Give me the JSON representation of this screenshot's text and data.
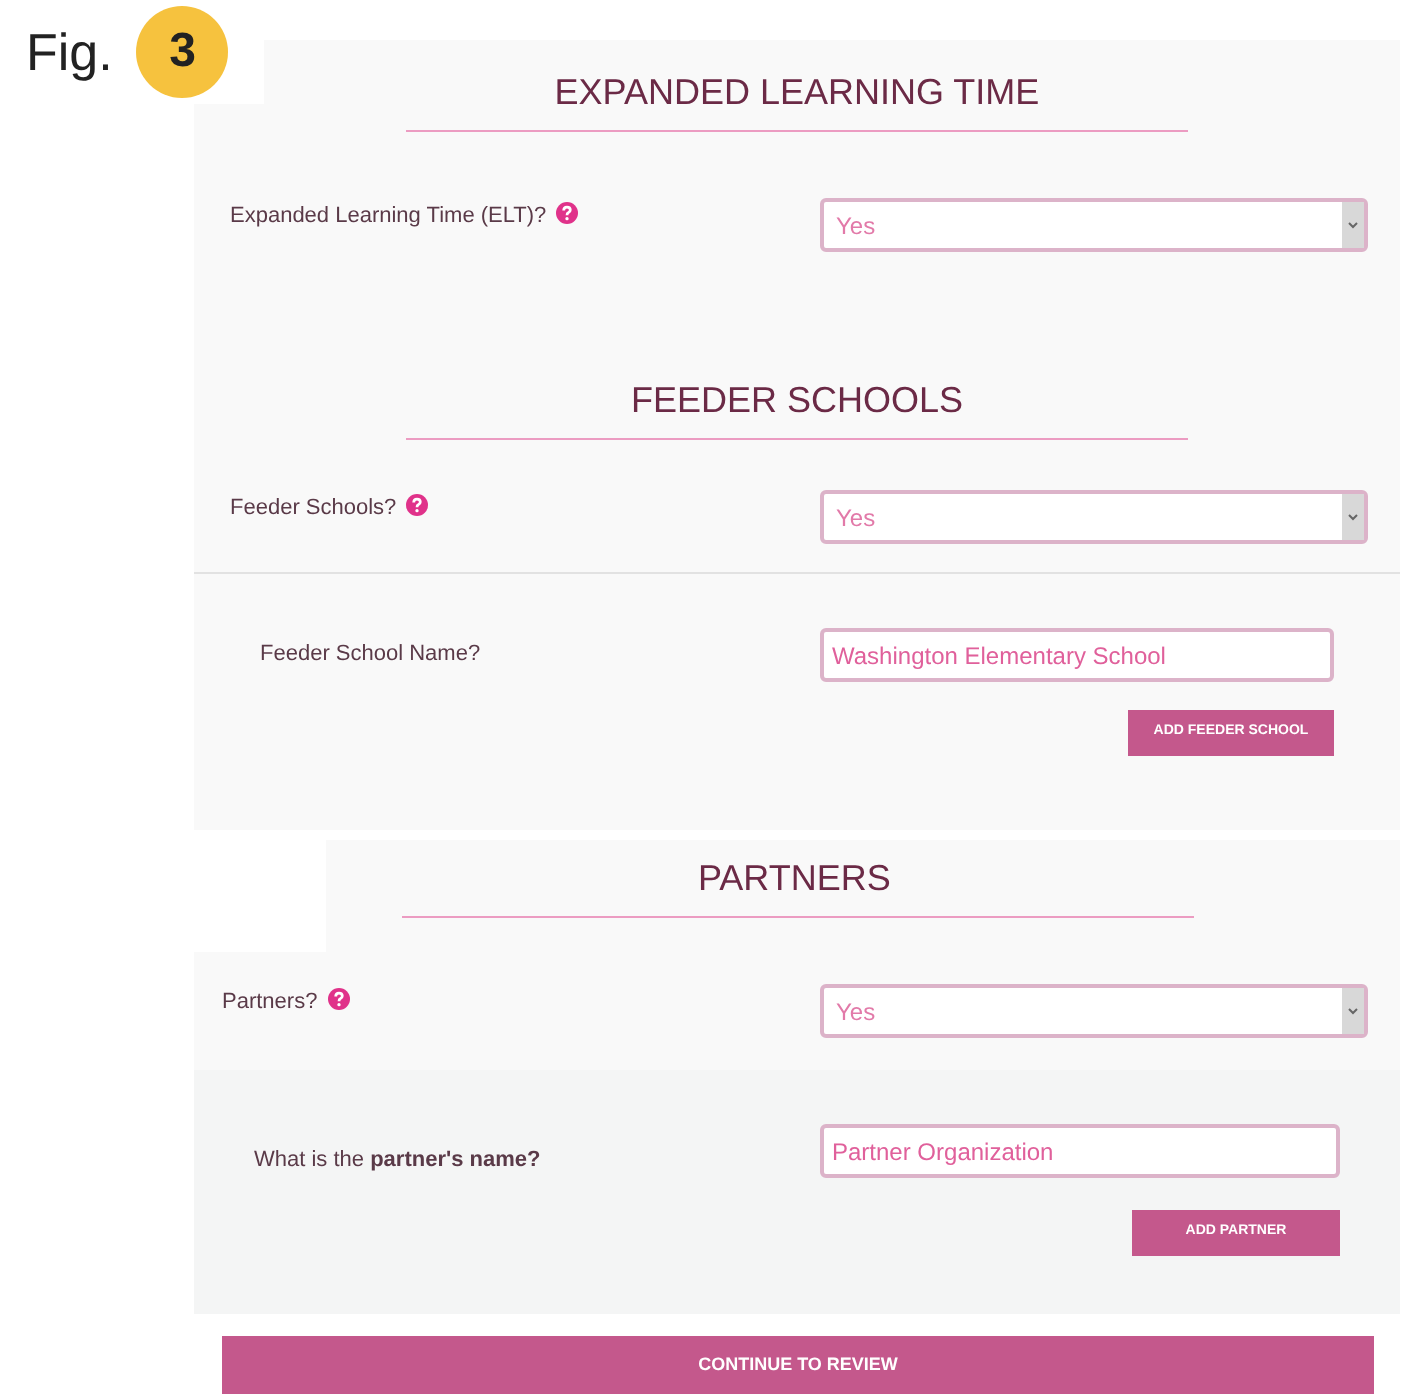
{
  "figure": {
    "label": "Fig.",
    "number": "3"
  },
  "sections": [
    {
      "heading": "EXPANDED LEARNING TIME",
      "question": {
        "label": "Expanded Learning Time (ELT)?",
        "value": "Yes"
      }
    },
    {
      "heading": "FEEDER SCHOOLS",
      "question": {
        "label": "Feeder Schools?",
        "value": "Yes"
      },
      "detail": {
        "label": "Feeder School Name?",
        "value": "Washington Elementary School",
        "button": "ADD FEEDER SCHOOL"
      }
    },
    {
      "heading": "PARTNERS",
      "question": {
        "label": "Partners?",
        "value": "Yes"
      },
      "detail": {
        "label": "What is the **partner's name?**",
        "value": "Partner Organization",
        "button": "ADD PARTNER"
      }
    }
  ],
  "continue_button": "CONTINUE TO REVIEW"
}
